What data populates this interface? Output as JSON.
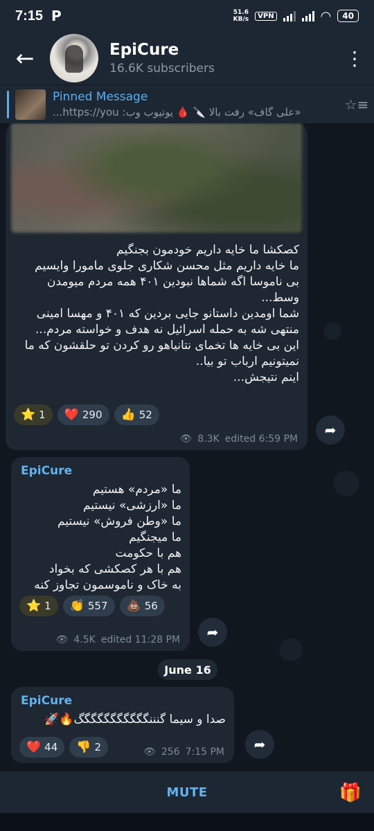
{
  "status_bar": {
    "time": "7:15",
    "app_glyph": "P",
    "net_speed_value": "51.6",
    "net_speed_unit": "KB/s",
    "vpn": "VPN",
    "battery": "40"
  },
  "header": {
    "back_icon": "arrow-left-icon",
    "title": "EpiCure",
    "subtitle": "16.6K subscribers",
    "menu_icon": "more-vertical-icon"
  },
  "pinned": {
    "label": "Pinned Message",
    "preview": "«علی گاف» رفت بالا 🔪 🩸 یوتیوب وب: https://you..."
  },
  "messages": [
    {
      "text": "کصکشا ما خایه داریم خودمون بجنگیم\nما خایه داریم مثل محسن شکاری جلوی مامورا وایسیم\nبی ناموسا اگه شماها نبودین ۴۰۱ همه مردم میومدن وسط...\nشما اومدین داستانو جایی بردین که ۴۰۱ و مهسا امینی منتهی شه به حمله اسرائیل نه هدف و خواسته مردم...\nاین بی خایه ها تخمای نتانیاهو رو کردن تو حلقشون که ما نمیتونیم ارباب تو بیا..\nاینم نتیجش...",
      "reactions": [
        {
          "emoji": "⭐",
          "count": "1"
        },
        {
          "emoji": "❤️",
          "count": "290"
        },
        {
          "emoji": "👍",
          "count": "52"
        }
      ],
      "views": "8.3K",
      "time": "edited 6:59 PM"
    },
    {
      "sender": "EpiCure",
      "text": "ما «مردم» هستیم\nما «ارزشی» نیستیم\nما «وطن فروش» نیستیم\nما میجنگیم\nهم با حکومت\nهم با هر کصکشی که بخواد\nبه خاک و ناموسمون تجاوز کنه",
      "reactions": [
        {
          "emoji": "⭐",
          "count": "1"
        },
        {
          "emoji": "👏",
          "count": "557"
        },
        {
          "emoji": "💩",
          "count": "56"
        }
      ],
      "views": "4.5K",
      "time": "edited 11:28 PM"
    },
    {
      "sender": "EpiCure",
      "text": "صدا و سیما گنننگگگگگگگگگگگ🔥🚀",
      "reactions": [
        {
          "emoji": "❤️",
          "count": "44"
        },
        {
          "emoji": "👎",
          "count": "2"
        }
      ],
      "views": "256",
      "time": "7:15 PM"
    }
  ],
  "date_separator": "June 16",
  "bottom": {
    "mute_label": "MUTE",
    "gift_icon": "gift-icon"
  },
  "colors": {
    "background": "#11171f",
    "bubble": "#1e2732",
    "accent": "#62b3f0",
    "header": "#1d2733"
  }
}
